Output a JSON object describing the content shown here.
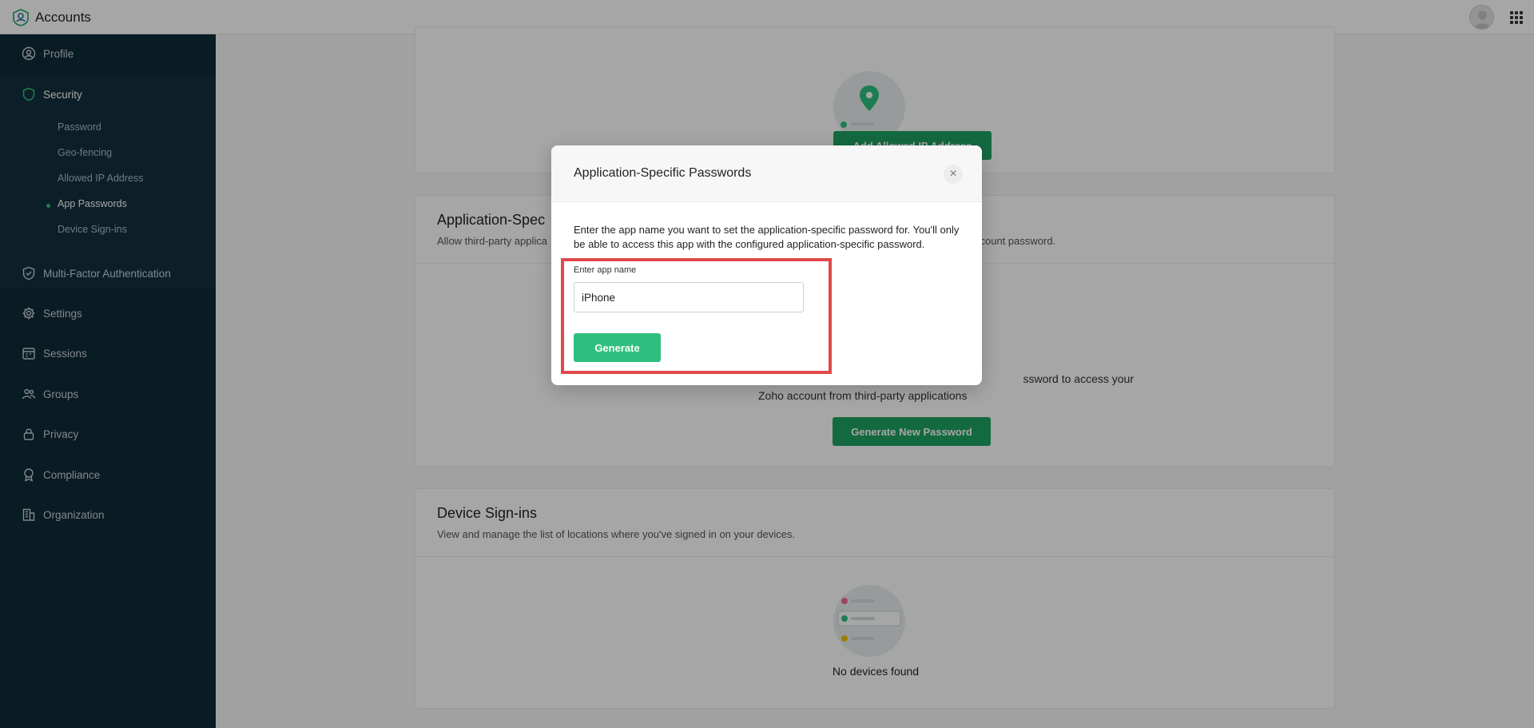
{
  "app": {
    "title": "Accounts"
  },
  "sidebar": {
    "items": [
      {
        "label": "Profile",
        "icon": "user-circle-icon"
      },
      {
        "label": "Security",
        "icon": "shield-icon"
      },
      {
        "label": "Multi-Factor Authentication",
        "icon": "shield-check-icon"
      },
      {
        "label": "Settings",
        "icon": "gear-icon"
      },
      {
        "label": "Sessions",
        "icon": "calendar-icon"
      },
      {
        "label": "Groups",
        "icon": "group-icon"
      },
      {
        "label": "Privacy",
        "icon": "lock-icon"
      },
      {
        "label": "Compliance",
        "icon": "badge-icon"
      },
      {
        "label": "Organization",
        "icon": "building-icon"
      }
    ],
    "security_sub": [
      "Password",
      "Geo-fencing",
      "Allowed IP Address",
      "App Passwords",
      "Device Sign-ins"
    ],
    "active_sub": "App Passwords"
  },
  "main": {
    "allowed_ip": {
      "button": "Add Allowed IP Address"
    },
    "app_passwords": {
      "title": "Application-Specific Passwords",
      "title_visible": "Application-Spec",
      "desc_left": "Allow third-party applica",
      "desc_right": "ccount password.",
      "body_line1": "ssword to access your",
      "body_line2": "Zoho account from third-party applications",
      "button": "Generate New Password"
    },
    "device_signins": {
      "title": "Device Sign-ins",
      "desc": "View and manage the list of locations where you've signed in on your devices.",
      "empty": "No devices found"
    }
  },
  "modal": {
    "title": "Application-Specific Passwords",
    "desc": "Enter the app name you want to set the application-specific password for. You'll only be able to access this app with the configured application-specific password.",
    "field_label": "Enter app name",
    "field_value": "iPhone",
    "generate": "Generate",
    "close": "×"
  },
  "colors": {
    "accent": "#2ebf7f",
    "sidebar": "#0e2a36",
    "highlight": "#e04a4a"
  }
}
